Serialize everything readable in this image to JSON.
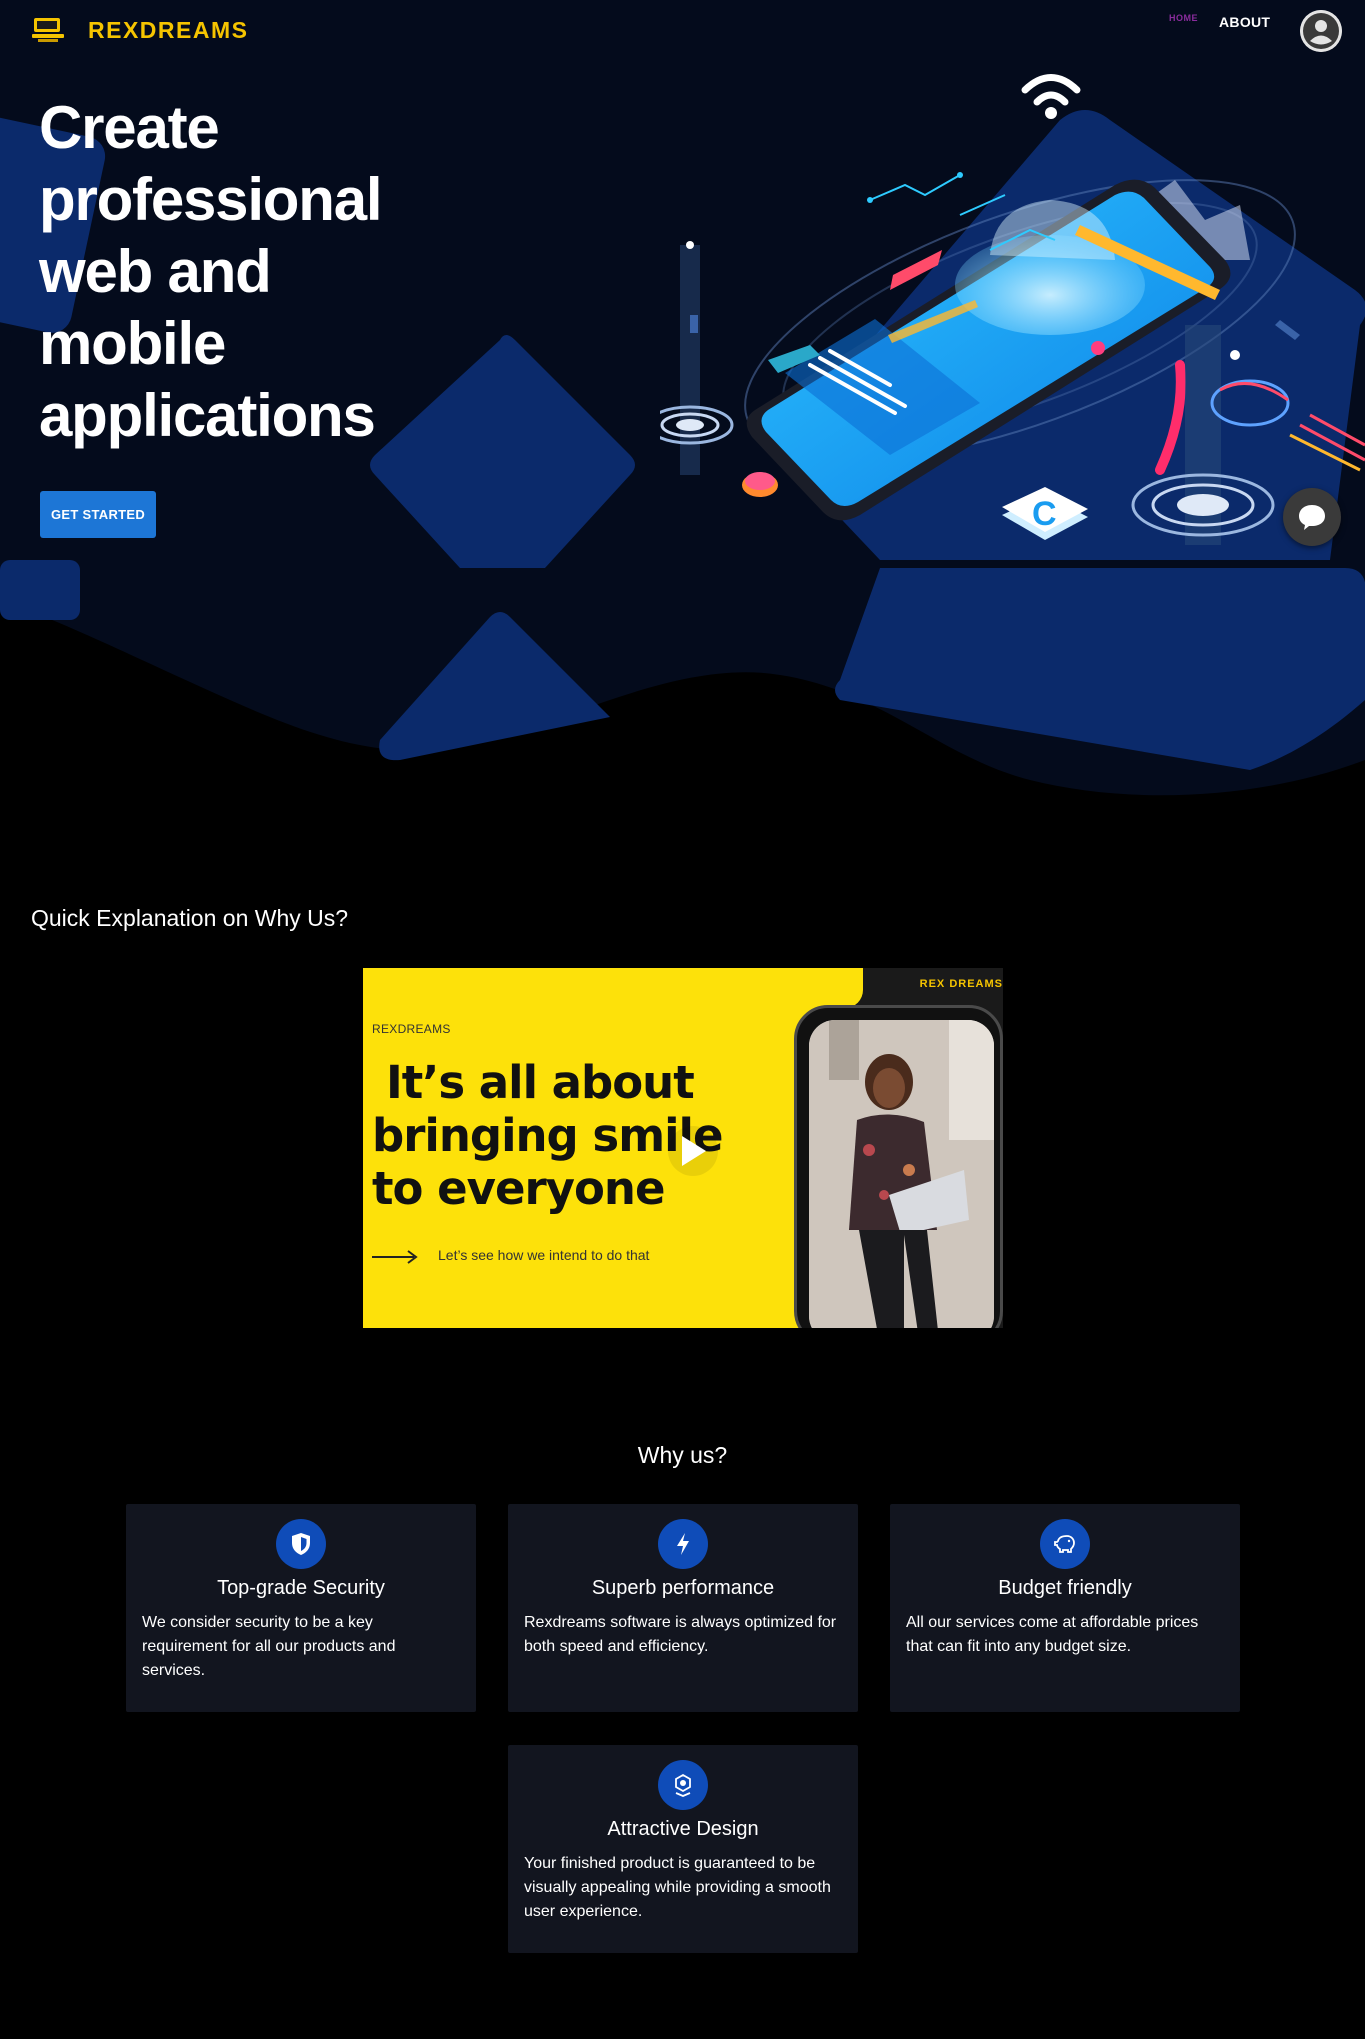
{
  "nav": {
    "brand": "REXDREAMS",
    "links": [
      {
        "label": "HOME",
        "active": true
      },
      {
        "label": "ABOUT",
        "active": false
      }
    ],
    "avatar_icon": "account-circle-icon"
  },
  "hero": {
    "title": "Create professional web and mobile applications",
    "cta_label": "GET STARTED"
  },
  "video_section": {
    "heading": "Quick Explanation on Why Us?",
    "thumbnail": {
      "brand": "REXDREAMS",
      "corner_brand": "REX DREAMS",
      "headline_line1": "It’s all about",
      "headline_line2": "bringing smile",
      "headline_line3": "to everyone",
      "subtext": "Let’s see how we intend to do that"
    },
    "play_icon": "play-icon"
  },
  "why_us": {
    "heading": "Why us?",
    "cards": [
      {
        "title": "Top-grade Security",
        "text": "We consider security to be a key requirement for all our products and services.",
        "icon": "shield-icon"
      },
      {
        "title": "Superb performance",
        "text": "Rexdreams software is always optimized for both speed and efficiency.",
        "icon": "lightning-icon"
      },
      {
        "title": "Budget friendly",
        "text": "All our services come at affordable prices that can fit into any budget size.",
        "icon": "piggy-bank-icon"
      },
      {
        "title": "Attractive Design",
        "text": "Your finished product is guaranteed to be visually appealing while providing a smooth user experience.",
        "icon": "design-icon"
      }
    ]
  },
  "chat_icon": "chat-bubble-icon",
  "colors": {
    "brand_yellow": "#f5c400",
    "accent_blue": "#1d76d6",
    "hero_navy": "#040b1c",
    "shape_blue": "#0b2a6b",
    "card_bg": "#12151f",
    "icon_circle": "#0f4cb8"
  }
}
